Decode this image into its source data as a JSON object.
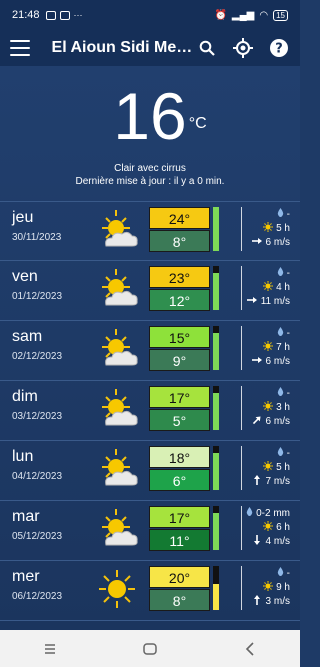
{
  "status": {
    "time": "21:48",
    "battery": "15"
  },
  "appbar": {
    "title": "El Aioun Sidi Me…"
  },
  "current": {
    "temperature": "16",
    "unit": "°C",
    "condition": "Clair avec cirrus",
    "last_update": "Dernière mise à jour : il y a 0 min."
  },
  "colors": {
    "bg": "#1e3a66",
    "appbar": "#152f58",
    "gauge_green": "#7ed957",
    "gauge_yellow": "#f7e547"
  },
  "days": [
    {
      "day": "jeu",
      "date": "30/11/2023",
      "icon": "sun-cloud-icon",
      "max": "24°",
      "min": "8°",
      "max_color": "#f6c912",
      "min_color": "#3b7a57",
      "gauge_fraction": 1.0,
      "gauge_color": "#7ed957",
      "precip": "-",
      "sun": "5 h",
      "wind": "6 m/s",
      "wind_dir": 0
    },
    {
      "day": "ven",
      "date": "01/12/2023",
      "icon": "sun-cloud-icon",
      "max": "23°",
      "min": "12°",
      "max_color": "#f6c912",
      "min_color": "#2f8f4f",
      "gauge_fraction": 0.85,
      "gauge_color": "#7ed957",
      "precip": "-",
      "sun": "4 h",
      "wind": "11 m/s",
      "wind_dir": 0
    },
    {
      "day": "sam",
      "date": "02/12/2023",
      "icon": "sun-cloud-icon",
      "max": "15°",
      "min": "9°",
      "max_color": "#8ee13a",
      "min_color": "#3b7a57",
      "gauge_fraction": 0.85,
      "gauge_color": "#7ed957",
      "precip": "-",
      "sun": "7 h",
      "wind": "6 m/s",
      "wind_dir": 0
    },
    {
      "day": "dim",
      "date": "03/12/2023",
      "icon": "sun-cloud-icon",
      "max": "17°",
      "min": "5°",
      "max_color": "#a6e33d",
      "min_color": "#2e8a4c",
      "gauge_fraction": 0.85,
      "gauge_color": "#7ed957",
      "precip": "-",
      "sun": "3 h",
      "wind": "6 m/s",
      "wind_dir": -45
    },
    {
      "day": "lun",
      "date": "04/12/2023",
      "icon": "sun-cloud-icon",
      "max": "18°",
      "min": "6°",
      "max_color": "#d9f0b5",
      "min_color": "#1ea34a",
      "gauge_fraction": 0.85,
      "gauge_color": "#7ed957",
      "precip": "-",
      "sun": "5 h",
      "wind": "7 m/s",
      "wind_dir": -90
    },
    {
      "day": "mar",
      "date": "05/12/2023",
      "icon": "sun-cloud-icon",
      "max": "17°",
      "min": "11°",
      "max_color": "#a6e33d",
      "min_color": "#137a32",
      "gauge_fraction": 0.85,
      "gauge_color": "#7ed957",
      "precip": "0-2 mm",
      "sun": "6 h",
      "wind": "4 m/s",
      "wind_dir": 90
    },
    {
      "day": "mer",
      "date": "06/12/2023",
      "icon": "sun-icon",
      "max": "20°",
      "min": "8°",
      "max_color": "#f7e547",
      "min_color": "#3b7a57",
      "gauge_fraction": 0.6,
      "gauge_color": "#f7e547",
      "precip": "-",
      "sun": "9 h",
      "wind": "3 m/s",
      "wind_dir": -90
    }
  ]
}
